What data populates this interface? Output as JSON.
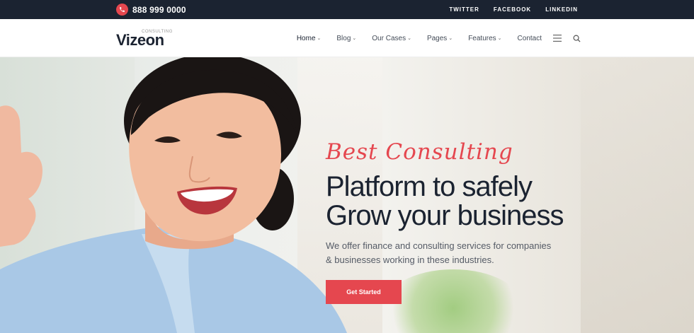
{
  "topbar": {
    "phone": "888 999 0000",
    "social": [
      "TWITTER",
      "FACEBOOK",
      "LINKEDIN"
    ]
  },
  "logo": {
    "name": "Vizeon",
    "tagline": "CONSULTING"
  },
  "nav": {
    "items": [
      {
        "label": "Home",
        "dropdown": true
      },
      {
        "label": "Blog",
        "dropdown": true
      },
      {
        "label": "Our Cases",
        "dropdown": true
      },
      {
        "label": "Pages",
        "dropdown": true
      },
      {
        "label": "Features",
        "dropdown": true
      },
      {
        "label": "Contact",
        "dropdown": false
      }
    ],
    "icons": [
      "hamburger-icon",
      "search-icon"
    ]
  },
  "hero": {
    "script_heading": "Best Consulting",
    "title_line1": "Platform to safely",
    "title_line2": "Grow your business",
    "description_line1": "We offer finance and consulting services for companies",
    "description_line2": "& businesses working in these industries.",
    "cta": "Get Started"
  },
  "colors": {
    "accent": "#e5474f",
    "dark": "#1b2331"
  }
}
